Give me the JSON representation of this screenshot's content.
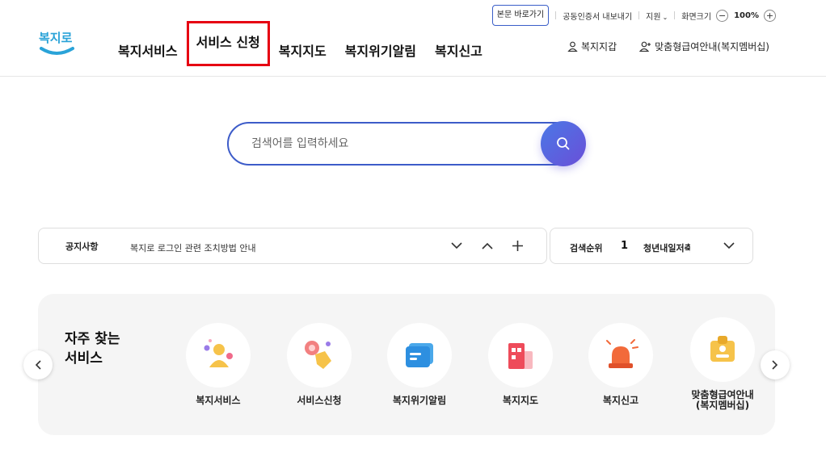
{
  "utility": {
    "skip_to_content": "본문 바로가기",
    "certificate_export": "공동인증서 내보내기",
    "support": "지원",
    "screen_size_label": "화면크기",
    "zoom_level": "100%"
  },
  "header": {
    "logo_text": "복지로",
    "nav": [
      {
        "label": "복지서비스"
      },
      {
        "label": "서비스 신청"
      },
      {
        "label": "복지지도"
      },
      {
        "label": "복지위기알림"
      },
      {
        "label": "복지신고"
      }
    ],
    "wallet_link": "복지지갑",
    "membership_link": "맞춤형급여안내(복지멤버십)"
  },
  "search": {
    "placeholder": "검색어를 입력하세요"
  },
  "notice": {
    "label": "공지사항",
    "text": "복지로 로그인 관련 조치방법 안내"
  },
  "ranking": {
    "label": "검색순위",
    "rank": "1",
    "keyword": "청년내일저축"
  },
  "frequent": {
    "title_line1": "자주 찾는",
    "title_line2": "서비스",
    "items": [
      {
        "label": "복지서비스"
      },
      {
        "label": "서비스신청"
      },
      {
        "label": "복지위기알림"
      },
      {
        "label": "복지지도"
      },
      {
        "label": "복지신고"
      },
      {
        "label_line1": "맞춤형급여안내",
        "label_line2": "(복지멤버십)"
      }
    ]
  },
  "colors": {
    "brand_blue": "#3d5cc9",
    "highlight_red": "#e60012",
    "panel_bg": "#f5f5f5"
  }
}
